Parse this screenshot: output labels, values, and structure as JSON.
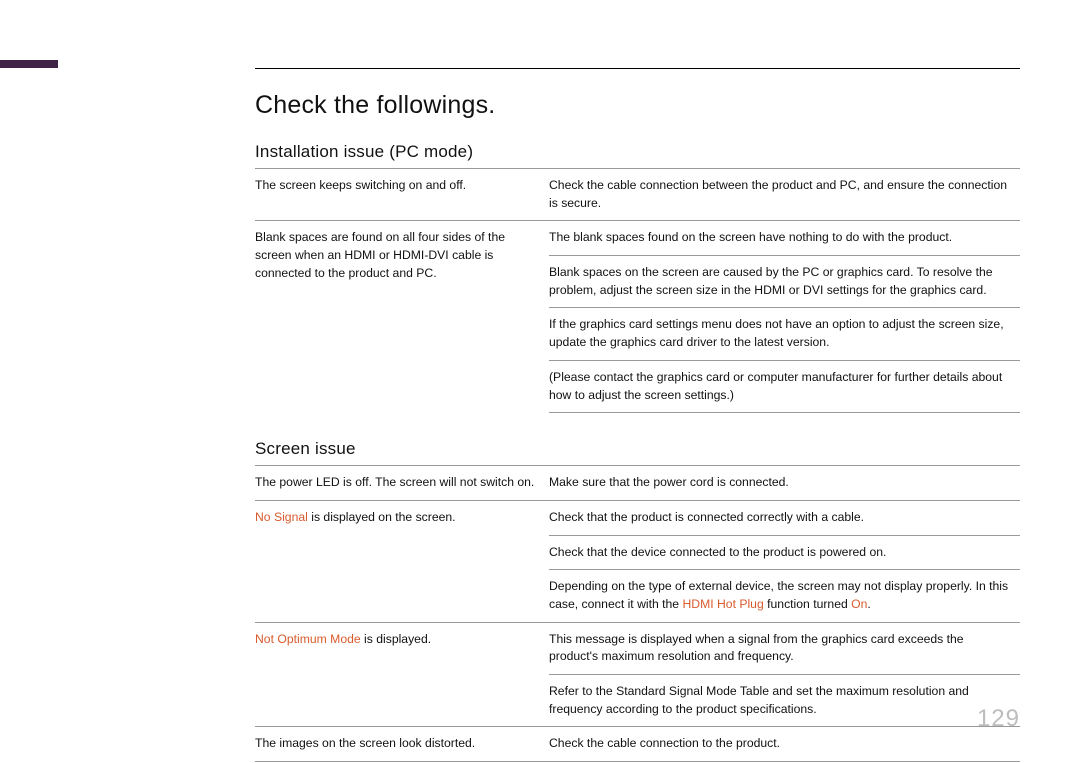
{
  "page_number": "129",
  "heading": "Check the followings.",
  "sections": [
    {
      "title": "Installation issue (PC mode)",
      "rows": [
        {
          "left": [
            {
              "t": "The screen keeps switching on and off."
            }
          ],
          "right": [
            [
              {
                "t": "Check the cable connection between the product and PC, and ensure the connection is secure."
              }
            ]
          ]
        },
        {
          "left": [
            {
              "t": "Blank spaces are found on all four sides of the screen when an HDMI or HDMI-DVI cable is connected to the product and PC."
            }
          ],
          "right": [
            [
              {
                "t": "The blank spaces found on the screen have nothing to do with the product."
              }
            ],
            [
              {
                "t": "Blank spaces on the screen are caused by the PC or graphics card. To resolve the problem, adjust the screen size in the HDMI or DVI settings for the graphics card."
              }
            ],
            [
              {
                "t": "If the graphics card settings menu does not have an option to adjust the screen size, update the graphics card driver to the latest version."
              }
            ],
            [
              {
                "t": "(Please contact the graphics card or computer manufacturer for further details about how to adjust the screen settings.)"
              }
            ]
          ]
        }
      ]
    },
    {
      "title": "Screen issue",
      "rows": [
        {
          "left": [
            {
              "t": "The power LED is off. The screen will not switch on."
            }
          ],
          "right": [
            [
              {
                "t": "Make sure that the power cord is connected."
              }
            ]
          ]
        },
        {
          "left": [
            {
              "t": "No Signal",
              "cls": "orange"
            },
            {
              "t": " is displayed on the screen."
            }
          ],
          "right": [
            [
              {
                "t": "Check that the product is connected correctly with a cable."
              }
            ],
            [
              {
                "t": "Check that the device connected to the product is powered on."
              }
            ],
            [
              {
                "t": "Depending on the type of external device, the screen may not display properly. In this case, connect it with the "
              },
              {
                "t": "HDMI Hot Plug",
                "cls": "orange"
              },
              {
                "t": " function turned "
              },
              {
                "t": "On",
                "cls": "orange"
              },
              {
                "t": "."
              }
            ]
          ]
        },
        {
          "left": [
            {
              "t": "Not Optimum Mode",
              "cls": "orange"
            },
            {
              "t": " is displayed."
            }
          ],
          "right": [
            [
              {
                "t": "This message is displayed when a signal from the graphics card exceeds the product's maximum resolution and frequency."
              }
            ],
            [
              {
                "t": "Refer to the Standard Signal Mode Table and set the maximum resolution and frequency according to the product specifications."
              }
            ]
          ]
        },
        {
          "left": [
            {
              "t": "The images on the screen look distorted."
            }
          ],
          "right": [
            [
              {
                "t": "Check the cable connection to the product."
              }
            ]
          ]
        }
      ]
    }
  ]
}
